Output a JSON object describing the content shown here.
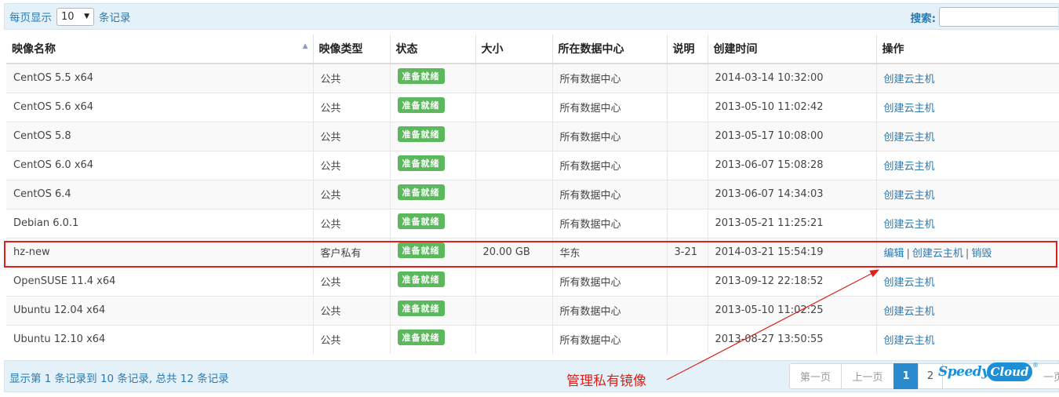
{
  "toolbar": {
    "show_prefix": "每页显示",
    "page_size": "10",
    "show_suffix": "条记录",
    "search_label": "搜索:",
    "search_value": ""
  },
  "columns": [
    "映像名称",
    "映像类型",
    "状态",
    "大小",
    "所在数据中心",
    "说明",
    "创建时间",
    "操作"
  ],
  "rows": [
    {
      "name": "CentOS 5.5 x64",
      "type": "公共",
      "status": "准备就绪",
      "size": "",
      "dc": "所有数据中心",
      "desc": "",
      "created": "2014-03-14 10:32:00",
      "actions": [
        "创建云主机"
      ]
    },
    {
      "name": "CentOS 5.6 x64",
      "type": "公共",
      "status": "准备就绪",
      "size": "",
      "dc": "所有数据中心",
      "desc": "",
      "created": "2013-05-10 11:02:42",
      "actions": [
        "创建云主机"
      ]
    },
    {
      "name": "CentOS 5.8",
      "type": "公共",
      "status": "准备就绪",
      "size": "",
      "dc": "所有数据中心",
      "desc": "",
      "created": "2013-05-17 10:08:00",
      "actions": [
        "创建云主机"
      ]
    },
    {
      "name": "CentOS 6.0 x64",
      "type": "公共",
      "status": "准备就绪",
      "size": "",
      "dc": "所有数据中心",
      "desc": "",
      "created": "2013-06-07 15:08:28",
      "actions": [
        "创建云主机"
      ]
    },
    {
      "name": "CentOS 6.4",
      "type": "公共",
      "status": "准备就绪",
      "size": "",
      "dc": "所有数据中心",
      "desc": "",
      "created": "2013-06-07 14:34:03",
      "actions": [
        "创建云主机"
      ]
    },
    {
      "name": "Debian 6.0.1",
      "type": "公共",
      "status": "准备就绪",
      "size": "",
      "dc": "所有数据中心",
      "desc": "",
      "created": "2013-05-21 11:25:21",
      "actions": [
        "创建云主机"
      ]
    },
    {
      "name": "hz-new",
      "type": "客户私有",
      "status": "准备就绪",
      "size": "20.00 GB",
      "dc": "华东",
      "desc": "3-21",
      "created": "2014-03-21 15:54:19",
      "actions": [
        "编辑",
        "创建云主机",
        "销毁"
      ]
    },
    {
      "name": "OpenSUSE 11.4 x64",
      "type": "公共",
      "status": "准备就绪",
      "size": "",
      "dc": "所有数据中心",
      "desc": "",
      "created": "2013-09-12 22:18:52",
      "actions": [
        "创建云主机"
      ]
    },
    {
      "name": "Ubuntu 12.04 x64",
      "type": "公共",
      "status": "准备就绪",
      "size": "",
      "dc": "所有数据中心",
      "desc": "",
      "created": "2013-05-10 11:02:25",
      "actions": [
        "创建云主机"
      ]
    },
    {
      "name": "Ubuntu 12.10 x64",
      "type": "公共",
      "status": "准备就绪",
      "size": "",
      "dc": "所有数据中心",
      "desc": "",
      "created": "2013-08-27 13:50:55",
      "actions": [
        "创建云主机"
      ]
    }
  ],
  "footer": {
    "info": "显示第 1 条记录到 10 条记录, 总共 12 条记录",
    "first_page": "第一页",
    "prev_page": "上一页",
    "current_page": "1",
    "next_page_partial": "2",
    "last_page_partial": "一页"
  },
  "annotation": {
    "text": "管理私有镜像",
    "color": "#d9221c"
  },
  "logo": {
    "part1": "Speedy",
    "part2": "Cloud",
    "reg": "®"
  },
  "colors": {
    "accent": "#2a7ab0",
    "status_ready": "#5cb85c",
    "highlight": "#d9221c",
    "active_page": "#2a8ad0"
  }
}
